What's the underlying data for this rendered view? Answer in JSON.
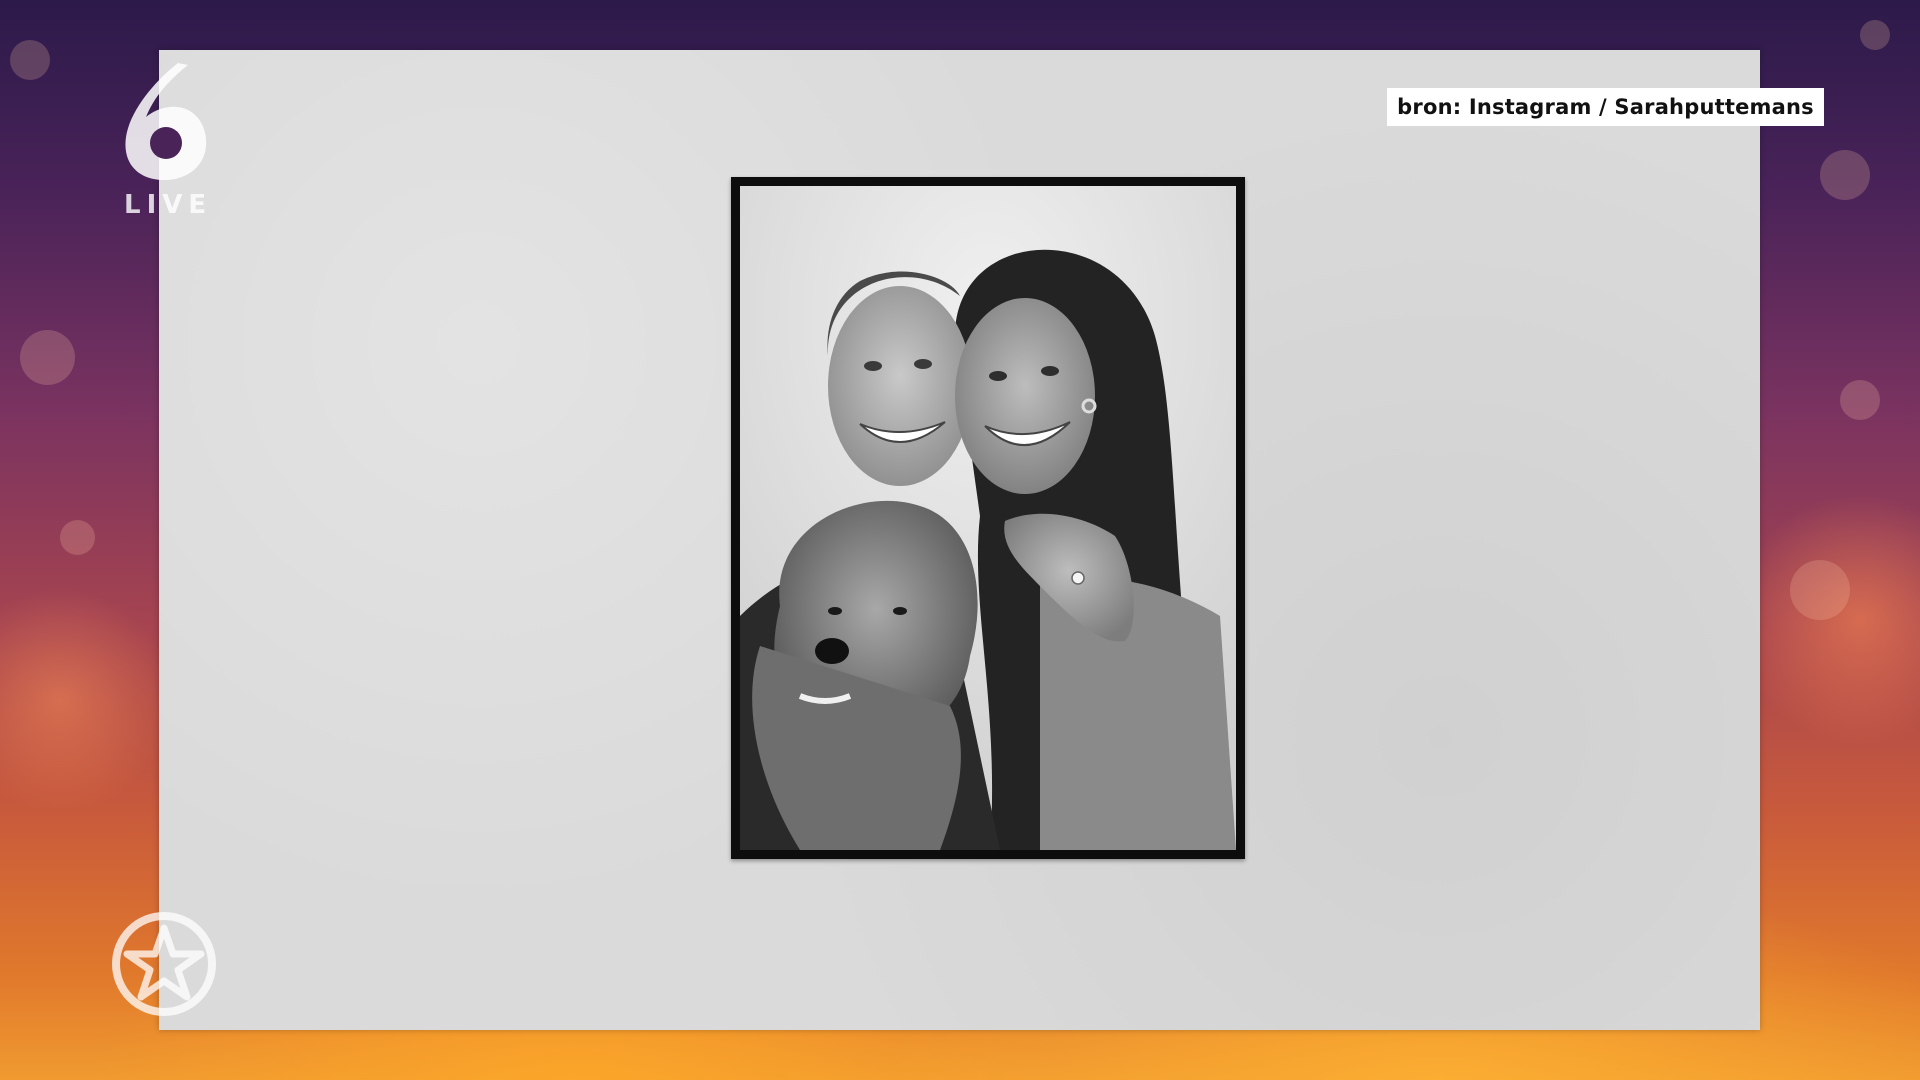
{
  "channel": {
    "logo_icon": "channel-6-logo-icon",
    "live_label": "LIVE"
  },
  "overlay": {
    "source_credit": "bron: Instagram / Sarahputtemans"
  },
  "photo": {
    "alt": "Black and white photobooth picture of a smiling couple with a small fluffy dog; the woman shows an engagement ring",
    "style": "black-and-white photobooth print"
  },
  "badge": {
    "icon": "star-in-circle-icon"
  },
  "colors": {
    "panel_background": "#dadada",
    "credit_background": "#ffffff",
    "credit_text": "#111111",
    "frame_border": "#0d0d0d",
    "background_top": "#2c1a4a",
    "background_bottom": "#f09a30"
  }
}
